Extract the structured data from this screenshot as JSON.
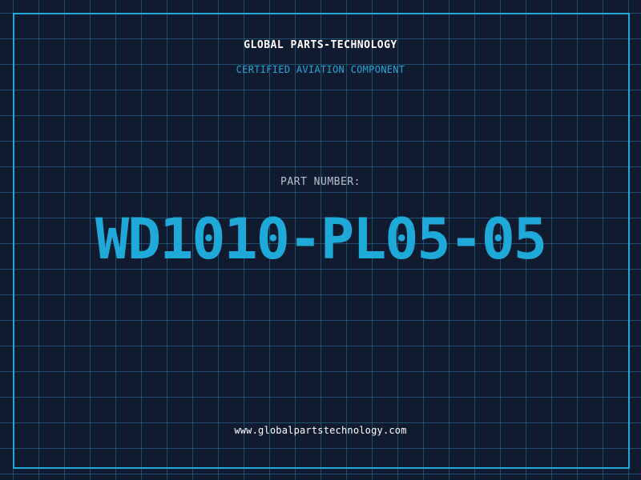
{
  "header": {
    "company": "GLOBAL PARTS-TECHNOLOGY",
    "subtitle": "CERTIFIED AVIATION COMPONENT"
  },
  "main": {
    "part_label": "PART NUMBER:",
    "part_number": "WD1010-PL05-05"
  },
  "footer": {
    "website": "www.globalpartstechnology.com"
  },
  "colors": {
    "background": "#111b30",
    "grid": "#28789f",
    "accent": "#1fa9d8",
    "white_text": "#ffffff",
    "label_text": "#b8c2cf"
  }
}
